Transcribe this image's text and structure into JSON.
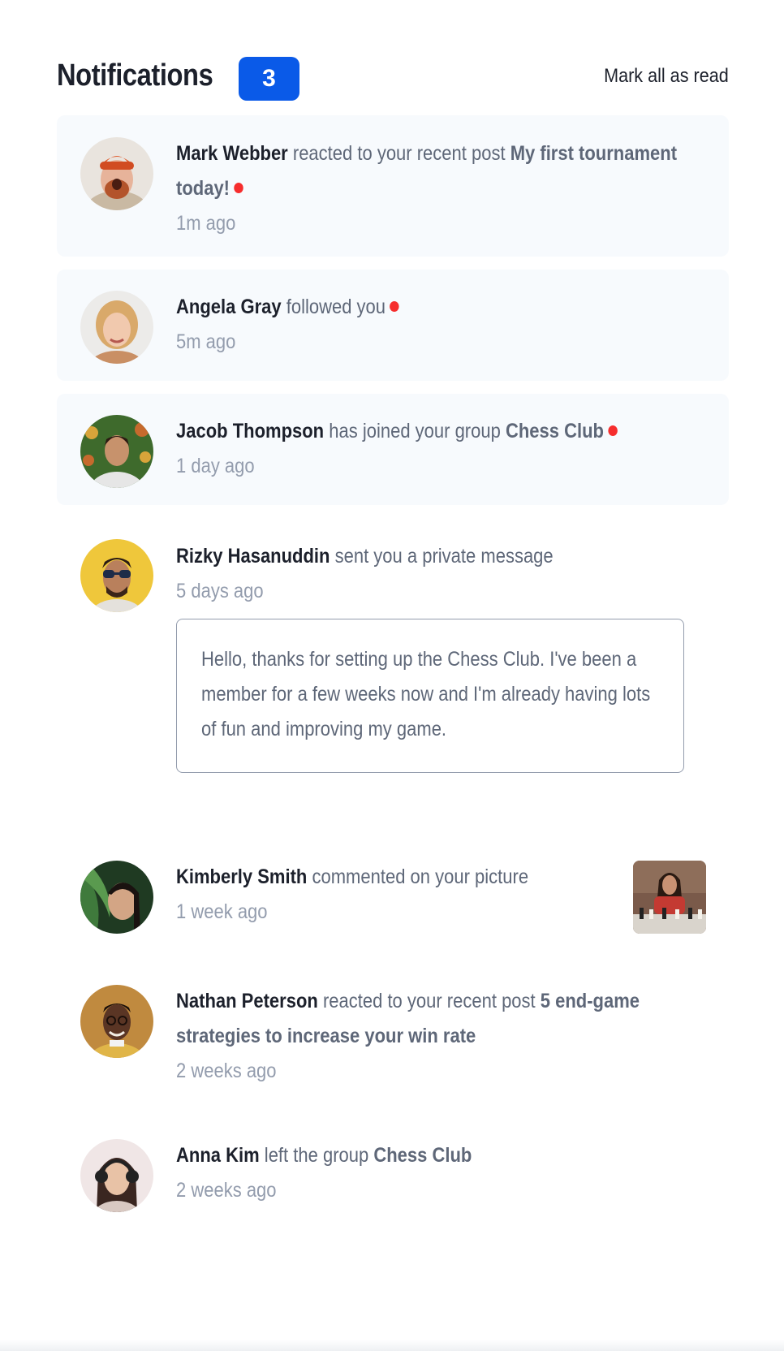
{
  "header": {
    "title": "Notifications",
    "unread_count": "3",
    "mark_all_label": "Mark all as read"
  },
  "colors": {
    "accent_blue": "#0a5ae8",
    "unread_dot": "#f62d2d",
    "unread_bg": "#f7fafd",
    "dark_text": "#1c202b",
    "muted_text": "#5e6778"
  },
  "notifications": [
    {
      "name": "Mark Webber",
      "action": "reacted to your recent post",
      "target": "My first tournament today!",
      "time": "1m ago",
      "unread": true,
      "avatar": "avatar-mark-webber"
    },
    {
      "name": "Angela Gray",
      "action": "followed you",
      "target": "",
      "time": "5m ago",
      "unread": true,
      "avatar": "avatar-angela-gray"
    },
    {
      "name": "Jacob Thompson",
      "action": "has joined your group",
      "target": "Chess Club",
      "time": "1 day ago",
      "unread": true,
      "avatar": "avatar-jacob-thompson"
    },
    {
      "name": "Rizky Hasanuddin",
      "action": "sent you a private message",
      "target": "",
      "time": "5 days ago",
      "unread": false,
      "avatar": "avatar-rizky-hasanuddin",
      "message_lines": [
        "Hello, thanks for setting up the Chess Club. I've been a",
        "member for a few weeks now and I'm already having lots",
        "of fun and improving my game."
      ]
    },
    {
      "name": "Kimberly Smith",
      "action": "commented on your picture",
      "target": "",
      "time": "1 week ago",
      "unread": false,
      "avatar": "avatar-kimberly-smith",
      "thumbnail": "chess-picture-thumbnail"
    },
    {
      "name": "Nathan Peterson",
      "action": "reacted to your recent post",
      "target": "5 end-game strategies to increase your win rate",
      "time": "2 weeks ago",
      "unread": false,
      "avatar": "avatar-nathan-peterson"
    },
    {
      "name": "Anna Kim",
      "action": "left the group",
      "target": "Chess Club",
      "time": "2 weeks ago",
      "unread": false,
      "avatar": "avatar-anna-kim"
    }
  ]
}
